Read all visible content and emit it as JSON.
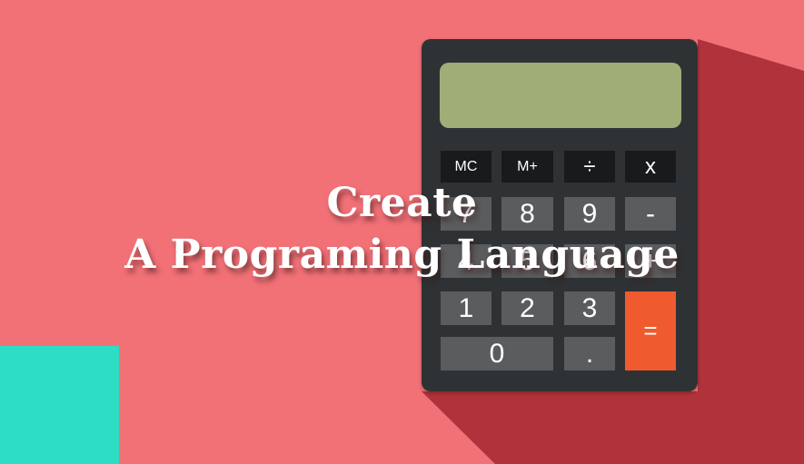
{
  "colors": {
    "background": "#f17177",
    "shadow": "#b0323a",
    "teal_block": "#2dddc4",
    "calculator_body": "#2f3234",
    "display": "#a0ad76",
    "function_key": "#181a1b",
    "number_key": "#5a5c5e",
    "equals_key": "#ef5a2e"
  },
  "title": {
    "line1": "Create",
    "line2": "A Programing Language"
  },
  "calculator": {
    "display_value": "",
    "keys": {
      "mc": "MC",
      "m_plus": "M+",
      "divide": "÷",
      "multiply": "x",
      "seven": "7",
      "eight": "8",
      "nine": "9",
      "minus": "-",
      "four": "4",
      "five": "5",
      "six": "6",
      "plus": "+",
      "one": "1",
      "two": "2",
      "three": "3",
      "equals": "=",
      "zero": "0",
      "decimal": "."
    }
  }
}
